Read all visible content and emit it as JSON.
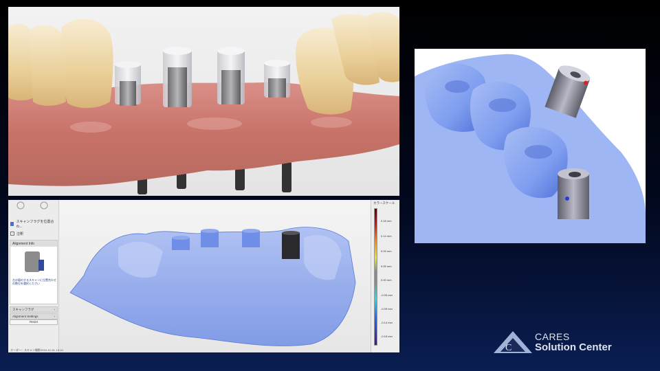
{
  "sidebar": {
    "scan_position_label": "スキャンフラグを位置合わ...",
    "note_label": "注釈",
    "alignment_info_title": "Alignment Info",
    "alignment_instruction": "左の図のするスキャンに位置合わせの数位を選択ください",
    "scanflag_menu": "スキャンフラグ",
    "alignment_settings_menu": "Alignment Settings",
    "reset_button": "Reset"
  },
  "colorscale": {
    "title": "カラースケール",
    "labels": [
      "0.18 mm",
      "0.14 mm",
      "0.09 mm",
      "0.05 mm",
      "0.00 mm",
      "-0.05 mm",
      "-0.09 mm",
      "-0.14 mm",
      "-0.18 mm"
    ],
    "gradient_colors": [
      "#5a0000",
      "#d81818",
      "#ff8800",
      "#e6e622",
      "#8a8a8a",
      "#22dddd",
      "#2266ff",
      "#3a1a90"
    ]
  },
  "status_bar": "オーダー：スキャン撮影2015-10-15, 15:10",
  "logo": {
    "line1": "CARES",
    "line2": "Solution Center"
  },
  "colors": {
    "gingiva": "#c97b70",
    "enamel": "#efd7a3",
    "scan_blue": "#7f9ef0",
    "abutment_gray": "#9a9aa6",
    "background_top": "#000000",
    "background_bottom": "#0a1e52"
  }
}
